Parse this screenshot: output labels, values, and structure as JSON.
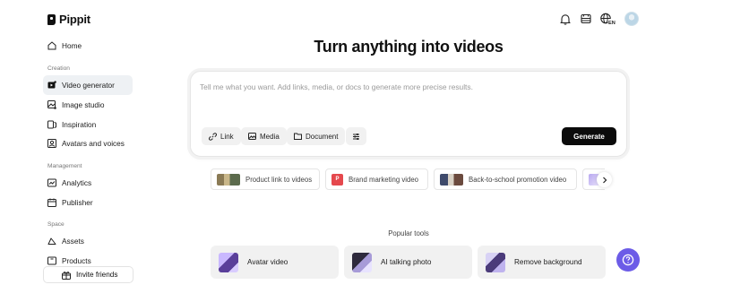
{
  "app": {
    "name": "Pippit"
  },
  "header": {
    "icons": [
      "bell-icon",
      "inbox-icon",
      "language-icon",
      "avatar"
    ],
    "language_code": "EN"
  },
  "sidebar": {
    "home": "Home",
    "sections": {
      "creation": "Creation",
      "management": "Management",
      "space": "Space"
    },
    "items": {
      "video_generator": "Video generator",
      "image_studio": "Image studio",
      "inspiration": "Inspiration",
      "avatars_and_voices": "Avatars and voices",
      "analytics": "Analytics",
      "publisher": "Publisher",
      "assets": "Assets",
      "products": "Products"
    },
    "invite": "Invite friends",
    "active": "Video generator"
  },
  "main": {
    "title": "Turn anything into videos",
    "prompt": {
      "placeholder": "Tell me what you want. Add links, media, or docs to generate more precise results.",
      "value": ""
    },
    "chips": {
      "link": "Link",
      "media": "Media",
      "document": "Document"
    },
    "generate": "Generate",
    "suggestions": [
      "Product link to videos",
      "Brand marketing video",
      "Back-to-school promotion video"
    ],
    "popular_tools_label": "Popular tools",
    "tools": [
      "Avatar video",
      "AI talking photo",
      "Remove background"
    ]
  },
  "colors": {
    "accent": "#6c5ce7",
    "generate_bg": "#0b0b0b",
    "active_nav_bg": "#eef1f4",
    "brand_tag": "#e5484d"
  }
}
